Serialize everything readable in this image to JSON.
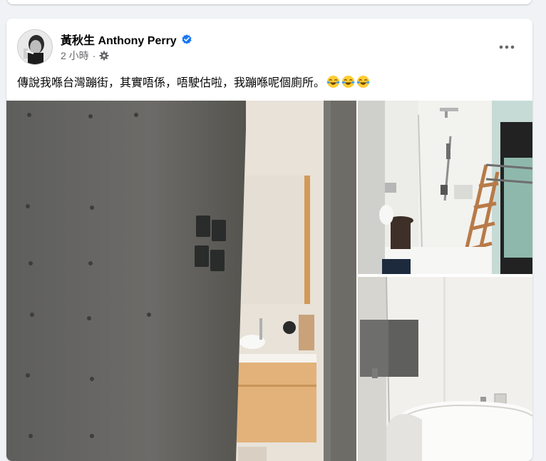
{
  "post": {
    "author_name": "黃秋生 Anthony Perry",
    "verified_icon": "verified-badge-icon",
    "timestamp": "2 小時",
    "separator": "·",
    "audience_icon": "gear-icon",
    "more_icon": "more-horizontal-icon",
    "text": "傳說我喺台灣蹦街，其實唔係，唔駛估啦，我蹦喺呢個廁所。",
    "emojis": [
      "laughing-tears-emoji",
      "laughing-tears-emoji",
      "laughing-tears-emoji"
    ]
  },
  "colors": {
    "verified": "#1877f2",
    "secondary_text": "#65676b",
    "primary_text": "#050505",
    "background": "#f0f2f5"
  },
  "photos": [
    {
      "subject": "concrete wall with light switches and bathroom vanity mirror"
    },
    {
      "subject": "shower area with towel ladder"
    },
    {
      "subject": "bathtub with wall mirror"
    }
  ]
}
